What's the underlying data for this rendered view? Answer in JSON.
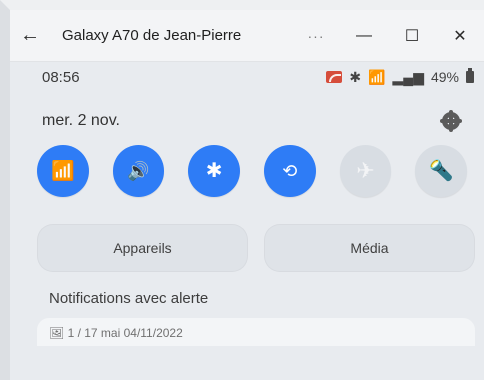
{
  "window": {
    "title": "Galaxy A70 de Jean-Pierre",
    "back_icon": "back-arrow-icon",
    "more_label": "···",
    "minimize_label": "—",
    "maximize_label": "☐",
    "close_label": "✕"
  },
  "status": {
    "time": "08:56",
    "battery_percent": "49%",
    "icons": [
      "cast-icon",
      "bluetooth-icon",
      "wifi-icon",
      "signal-icon",
      "battery-icon"
    ]
  },
  "date_row": {
    "date": "mer. 2 nov.",
    "settings_icon": "gear-icon"
  },
  "quick_settings": [
    {
      "name": "wifi",
      "icon": "wifi-icon",
      "glyph": "📶",
      "active": true
    },
    {
      "name": "sound",
      "icon": "sound-icon",
      "glyph": "🔊",
      "active": true
    },
    {
      "name": "bluetooth",
      "icon": "bluetooth-icon",
      "glyph": "✱",
      "active": true
    },
    {
      "name": "auto-rotate",
      "icon": "rotate-icon",
      "glyph": "⟲",
      "active": true
    },
    {
      "name": "airplane",
      "icon": "airplane-icon",
      "glyph": "✈",
      "active": false
    },
    {
      "name": "flashlight",
      "icon": "flashlight-icon",
      "glyph": "🔦",
      "active": false
    }
  ],
  "shortcuts": {
    "devices_label": "Appareils",
    "media_label": "Média"
  },
  "notifications": {
    "section_title": "Notifications avec alerte",
    "preview_text": "🖼 1 / 17 mai 04/11/2022"
  },
  "colors": {
    "active_blue": "#2e7cf6",
    "inactive_gray": "#d8dde3",
    "background": "#e8ebef"
  }
}
